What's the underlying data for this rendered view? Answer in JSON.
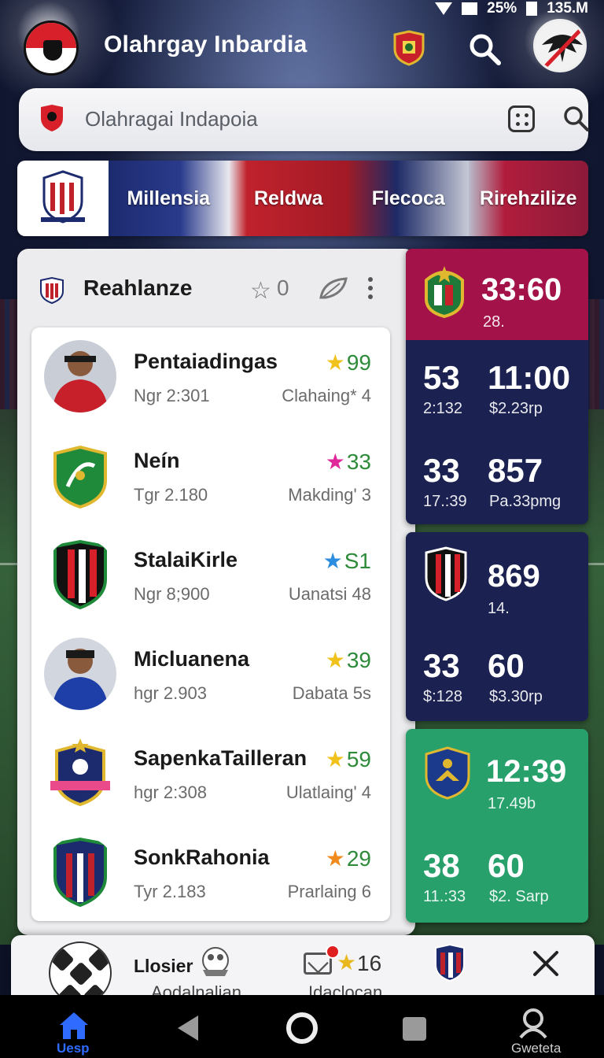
{
  "status_bar": {
    "time": "135.M",
    "battery": "25%"
  },
  "app": {
    "title": "Olahrgay Inbardia"
  },
  "search": {
    "placeholder": "Olahragai Indapoia"
  },
  "tabs": [
    {
      "label": "Millensia"
    },
    {
      "label": "Reldwa"
    },
    {
      "label": "Flecoca"
    },
    {
      "label": "Rirehzilize"
    }
  ],
  "main_card": {
    "title": "Reahlanze",
    "favorite_count": "0"
  },
  "list_items": [
    {
      "name": "Pentaiadingas",
      "sub": "Ngr 2:301",
      "rating": "99",
      "star_color": "#f1c21c",
      "right_sub": "Clahaing* 4",
      "pic": "player-red"
    },
    {
      "name": "Neín",
      "sub": "Tgr 2.180",
      "rating": "33",
      "star_color": "#e0289a",
      "right_sub": "Makding' 3",
      "pic": "crest-green"
    },
    {
      "name": "StalaiKirle",
      "sub": "Ngr 8;900",
      "rating": "S1",
      "star_color": "#2b8de0",
      "right_sub": "Uanatsi 48",
      "pic": "crest-redblack"
    },
    {
      "name": "Micluanena",
      "sub": "hgr 2.903",
      "rating": "39",
      "star_color": "#f1c21c",
      "right_sub": "Dabata 5s",
      "pic": "player-blue"
    },
    {
      "name": "SapenkaTailleran",
      "sub": "hgr 2:308",
      "rating": "59",
      "star_color": "#f1c21c",
      "right_sub": "Ulatlaing' 4",
      "pic": "crest-navy"
    },
    {
      "name": "SonkRahonia",
      "sub": "Tyr 2.183",
      "rating": "29",
      "star_color": "#f08a1c",
      "right_sub": "Prarlaing 6",
      "pic": "crest-striped"
    }
  ],
  "score_panels": [
    {
      "header": {
        "score": "33:60",
        "sub": "28."
      },
      "rows": [
        {
          "left_big": "53",
          "left_small": "2:132",
          "right_big": "11:00",
          "right_small": "$2.23rp"
        },
        {
          "left_big": "33",
          "left_small": "17.:39",
          "right_big": "857",
          "right_small": "Pa.33pmg"
        }
      ]
    },
    {
      "header": {
        "score": "869",
        "sub": "14."
      },
      "rows": [
        {
          "left_big": "33",
          "left_small": "$:128",
          "right_big": "60",
          "right_small": "$3.30rp"
        }
      ]
    },
    {
      "header": {
        "score": "12:39",
        "sub": "17.49b"
      },
      "rows": [
        {
          "left_big": "38",
          "left_small": "11.:33",
          "right_big": "60",
          "right_small": "$2. Sarp"
        }
      ]
    }
  ],
  "bottom_panel": {
    "label": "Llosier",
    "sub_label_left": "Aodalnalian",
    "count": "16",
    "sub_label_right": "Idaclocan"
  },
  "nav": {
    "home_label": "Uesp",
    "search_label": "Gweteta"
  },
  "colors": {
    "accent_blue": "#2f6bff",
    "score_header": "#a3134a",
    "score_navy": "#1b2150",
    "score_green": "#27a06c",
    "rating_green": "#2e8b3a"
  }
}
